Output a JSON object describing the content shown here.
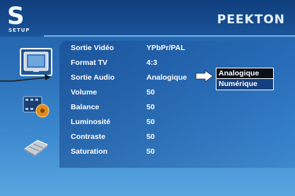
{
  "header": {
    "setup_glyph": "S",
    "setup_label": "SETUP",
    "brand": "PEEKTON"
  },
  "sidebar": {
    "icons": [
      {
        "name": "tv-icon",
        "selected": true
      },
      {
        "name": "film-icon",
        "selected": false
      },
      {
        "name": "chip-icon",
        "selected": false
      }
    ]
  },
  "menu": {
    "rows": [
      {
        "label": "Sortie Vidéo",
        "value": "YPbPr/PAL"
      },
      {
        "label": "Format TV",
        "value": "4:3"
      },
      {
        "label": "Sortie Audio",
        "value": "Analogique"
      },
      {
        "label": "Volume",
        "value": "50"
      },
      {
        "label": "Balance",
        "value": "50"
      },
      {
        "label": "Luminosité",
        "value": "50"
      },
      {
        "label": "Contraste",
        "value": "50"
      },
      {
        "label": "Saturation",
        "value": "50"
      }
    ]
  },
  "dropdown": {
    "options": [
      "Analogique",
      "Numérique"
    ],
    "selected": "Analogique"
  },
  "colors": {
    "background_top": "#1e5fa6",
    "background_bottom": "#5aa6e0",
    "highlight": "#0a0f1a",
    "text": "#ffffff"
  }
}
